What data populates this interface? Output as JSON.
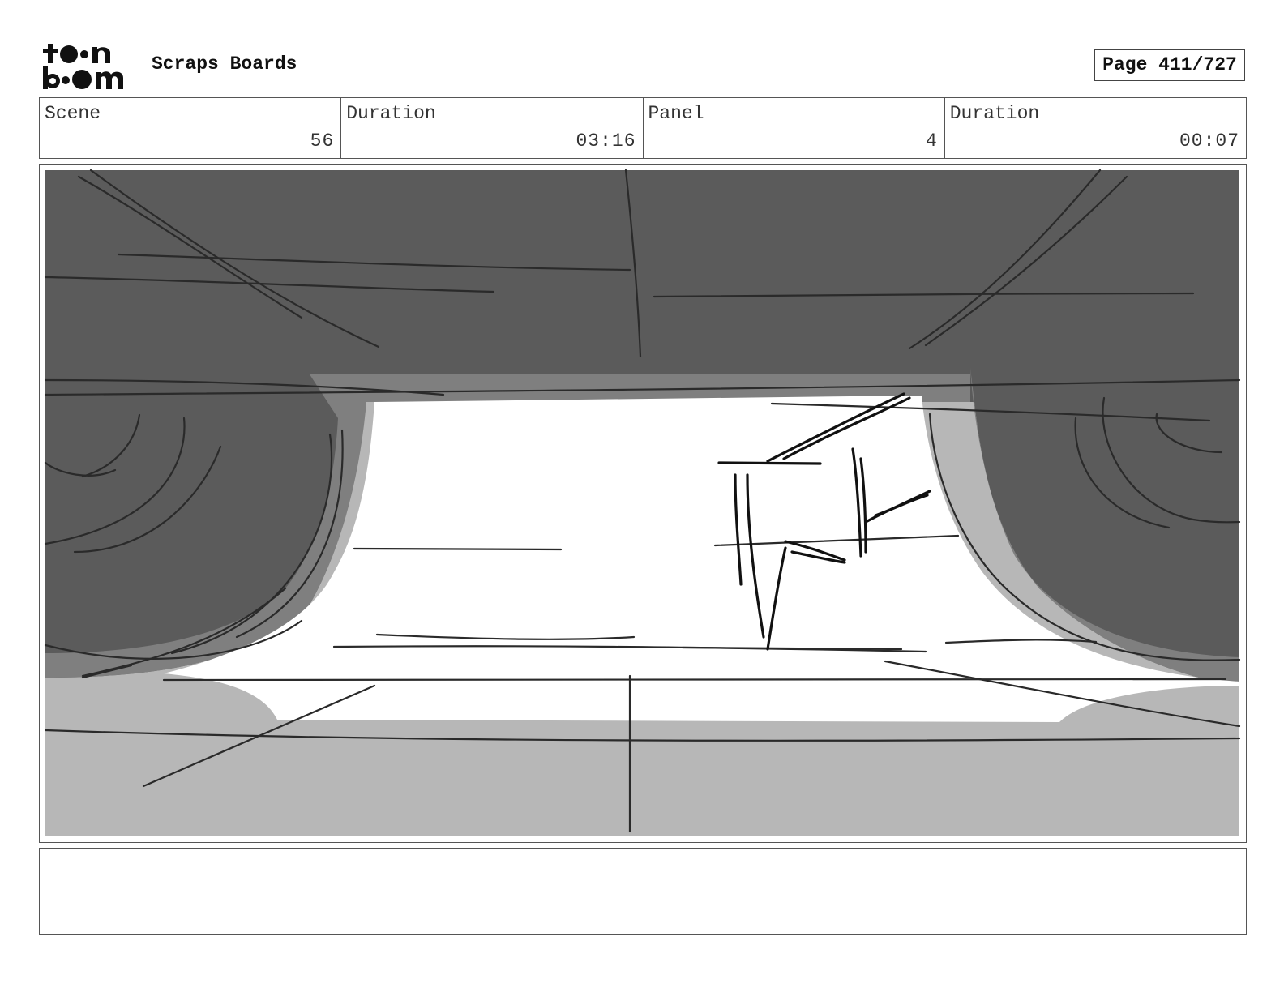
{
  "header": {
    "logo_text": "toon boom",
    "board_title": "Scraps Boards",
    "page_label": "Page 411/727"
  },
  "info": {
    "scene_label": "Scene",
    "scene_value": "56",
    "scene_duration_label": "Duration",
    "scene_duration_value": "03:16",
    "panel_label": "Panel",
    "panel_value": "4",
    "panel_duration_label": "Duration",
    "panel_duration_value": "00:07"
  },
  "notes": {
    "text": ""
  },
  "colors": {
    "dark_gray": "#5b5b5b",
    "mid_gray": "#7f7f7f",
    "light_gray": "#b7b7b7",
    "ink": "#222222"
  }
}
